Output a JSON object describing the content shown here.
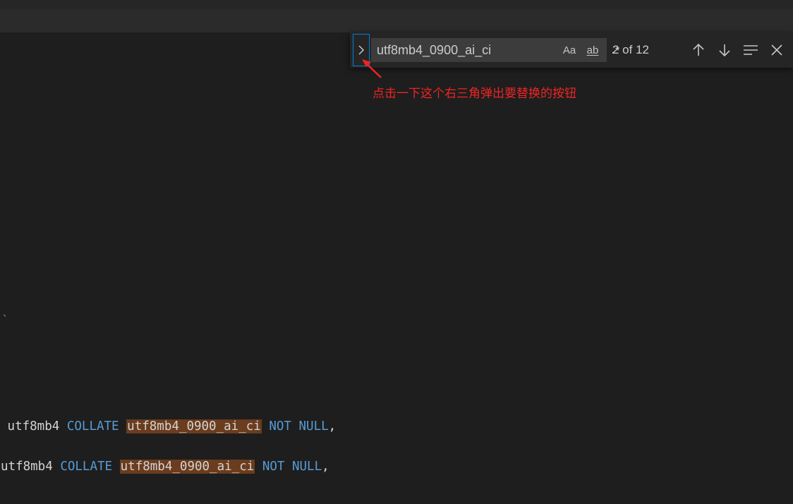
{
  "find": {
    "query": "utf8mb4_0900_ai_ci",
    "match_case_label": "Aa",
    "whole_word_label": "ab",
    "regex_label": ".*",
    "match_count": "2 of 12"
  },
  "annotation": {
    "text": "点击一下这个右三角弹出要替换的按钮"
  },
  "editor": {
    "stray_char": "`",
    "lines": [
      {
        "charset": " utf8mb4",
        "collate": "COLLATE",
        "match": "utf8mb4_0900_ai_ci",
        "not": "NOT",
        "null": "NULL",
        "tail": ","
      },
      {
        "charset": "utf8mb4",
        "collate": "COLLATE",
        "match": "utf8mb4_0900_ai_ci",
        "not": "NOT",
        "null": "NULL",
        "tail": ","
      }
    ]
  },
  "colors": {
    "background": "#1e1e1e",
    "keyword": "#569cd6",
    "match_highlight": "#6b3c1d",
    "focus_border": "#007fd4",
    "annotation": "#f02424"
  }
}
